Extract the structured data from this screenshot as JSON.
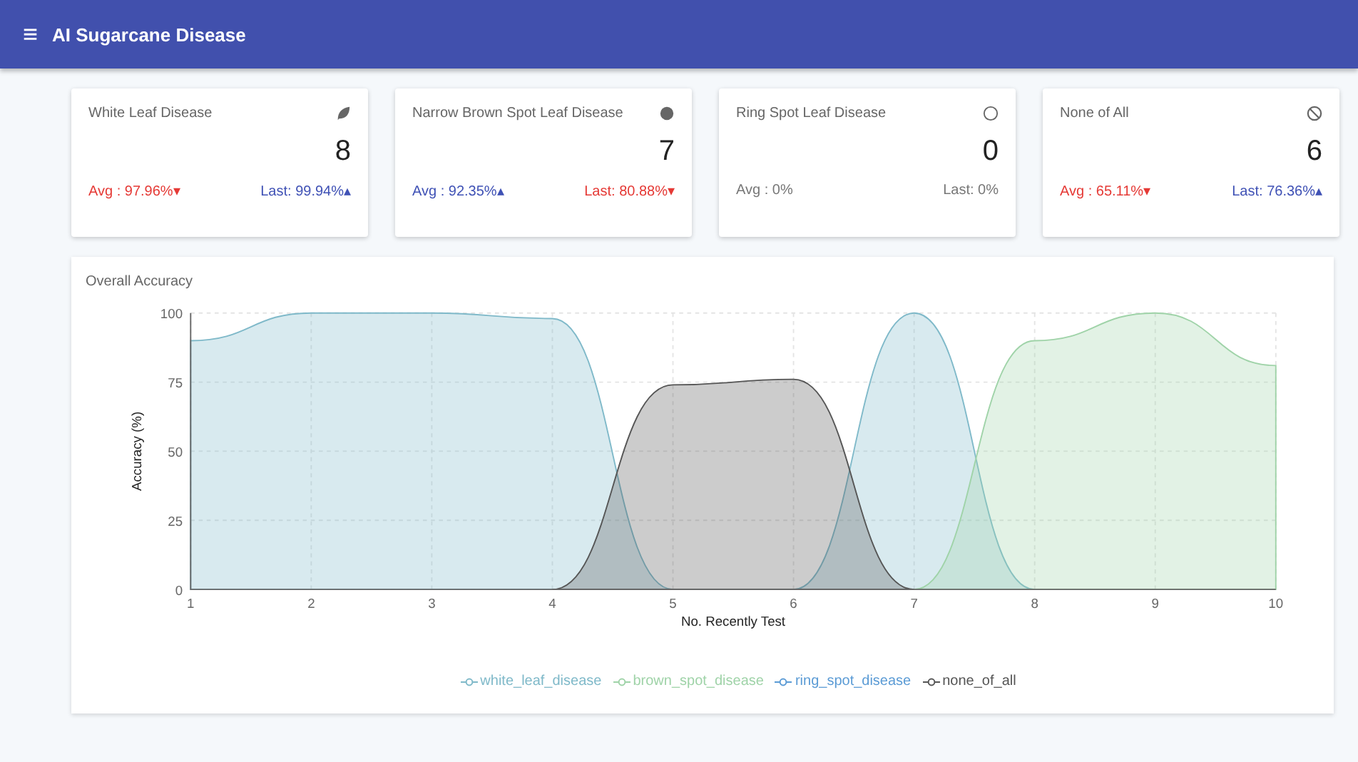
{
  "app_bar": {
    "menu_icon": "≡",
    "title": "AI Sugarcane Disease"
  },
  "cards": [
    {
      "title": "White Leaf Disease",
      "count": "8",
      "avg": {
        "text": "Avg : 97.96%",
        "arrow": "▾",
        "color": "#e53935"
      },
      "last": {
        "text": "Last: 99.94%",
        "arrow": "▴",
        "color": "#3f51b5"
      }
    },
    {
      "title": "Narrow Brown Spot Leaf Disease",
      "count": "7",
      "avg": {
        "text": "Avg : 92.35%",
        "arrow": "▴",
        "color": "#3f51b5"
      },
      "last": {
        "text": "Last: 80.88%",
        "arrow": "▾",
        "color": "#e53935"
      }
    },
    {
      "title": "Ring Spot Leaf Disease",
      "count": "0",
      "avg": {
        "text": "Avg : 0%",
        "color": "#777777"
      },
      "last": {
        "text": "Last: 0%",
        "color": "#777777"
      }
    },
    {
      "title": "None of All",
      "count": "6",
      "avg": {
        "text": "Avg : 65.11%",
        "arrow": "▾",
        "color": "#e53935"
      },
      "last": {
        "text": "Last: 76.36%",
        "arrow": "▴",
        "color": "#3f51b5"
      }
    }
  ],
  "accuracy_panel": {
    "title": "Overall Accuracy",
    "chart_data": {
      "type": "area",
      "xlabel": "No. Recently Test",
      "ylabel": "Accuracy (%)",
      "x": [
        1,
        2,
        3,
        4,
        5,
        6,
        7,
        8,
        9,
        10
      ],
      "xlim": [
        1,
        10
      ],
      "xticks": [
        1,
        2,
        3,
        4,
        5,
        6,
        7,
        8,
        9,
        10
      ],
      "ylim": [
        0,
        100
      ],
      "yticks": [
        0,
        25,
        50,
        75,
        100
      ],
      "grid": true,
      "series": [
        {
          "name": "white_leaf_disease",
          "color": "#7fb9c9",
          "values": [
            90,
            100,
            100,
            98,
            0,
            0,
            100,
            0,
            null,
            null
          ]
        },
        {
          "name": "brown_spot_disease",
          "color": "#9fd3a8",
          "values": [
            null,
            null,
            null,
            null,
            null,
            null,
            0,
            90,
            100,
            81
          ]
        },
        {
          "name": "ring_spot_disease",
          "color": "#5b9bd5",
          "values": [
            null,
            null,
            null,
            null,
            null,
            null,
            null,
            null,
            null,
            null
          ]
        },
        {
          "name": "none_of_all",
          "color": "#555555",
          "values": [
            null,
            null,
            null,
            0,
            74,
            76,
            0,
            null,
            null,
            null
          ]
        }
      ]
    }
  }
}
